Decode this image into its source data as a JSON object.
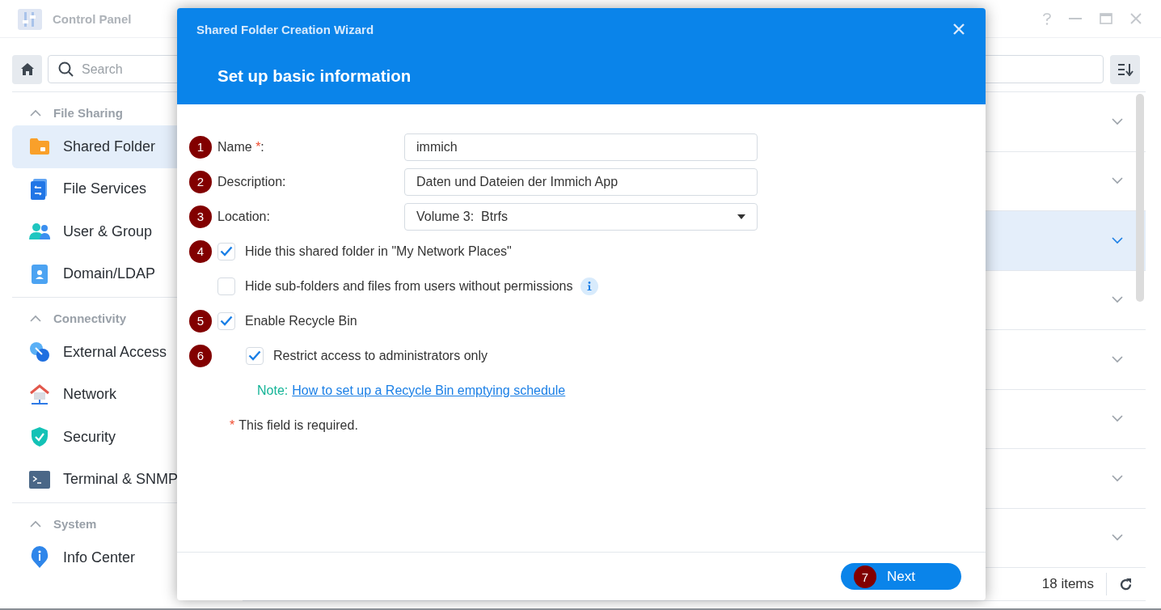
{
  "window": {
    "title": "Control Panel"
  },
  "toolbar": {
    "search": {
      "placeholder": "Search"
    }
  },
  "sidebar": {
    "sections": [
      {
        "title": "File Sharing",
        "expanded": true,
        "items": [
          {
            "label": "Shared Folder",
            "selected": true
          },
          {
            "label": "File Services",
            "selected": false
          },
          {
            "label": "User & Group",
            "selected": false
          },
          {
            "label": "Domain/LDAP",
            "selected": false
          }
        ]
      },
      {
        "title": "Connectivity",
        "expanded": true,
        "items": [
          {
            "label": "External Access",
            "selected": false
          },
          {
            "label": "Network",
            "selected": false
          },
          {
            "label": "Security",
            "selected": false
          },
          {
            "label": "Terminal & SNMP",
            "selected": false
          }
        ]
      },
      {
        "title": "System",
        "expanded": true,
        "items": [
          {
            "label": "Info Center",
            "selected": false
          }
        ]
      }
    ]
  },
  "list": {
    "rows": [
      {
        "selected": false
      },
      {
        "selected": false
      },
      {
        "selected": true
      },
      {
        "selected": false
      },
      {
        "selected": false
      },
      {
        "selected": false
      },
      {
        "selected": false
      },
      {
        "selected": false
      }
    ],
    "count": "18 items"
  },
  "dialog": {
    "title": "Shared Folder Creation Wizard",
    "heading": "Set up basic information",
    "fields": [
      {
        "kind": "text",
        "marker": "1",
        "label": "Name",
        "required_mark": "*",
        "label_suffix": ":",
        "value": "immich"
      },
      {
        "kind": "text",
        "marker": "2",
        "label": "Description:",
        "value": "Daten und Dateien der Immich App"
      },
      {
        "kind": "select",
        "marker": "3",
        "label": "Location:",
        "value": "Volume 3:  Btrfs"
      }
    ],
    "options": [
      {
        "marker": "4",
        "label": "Hide this shared folder in \"My Network Places\"",
        "checked": true,
        "info": false
      },
      {
        "label": "Hide sub-folders and files from users without permissions",
        "checked": false,
        "info": true
      },
      {
        "marker": "5",
        "label": "Enable Recycle Bin",
        "checked": true,
        "info": false,
        "children": [
          {
            "marker": "6",
            "label": "Restrict access to administrators only",
            "checked": true,
            "info": false
          }
        ]
      }
    ],
    "note": {
      "label": "Note:",
      "link": "How to set up a Recycle Bin emptying schedule"
    },
    "required_note": {
      "mark": "*",
      "text": "This field is required."
    },
    "buttons": [
      {
        "label": "Next",
        "marker": "7"
      }
    ]
  }
}
